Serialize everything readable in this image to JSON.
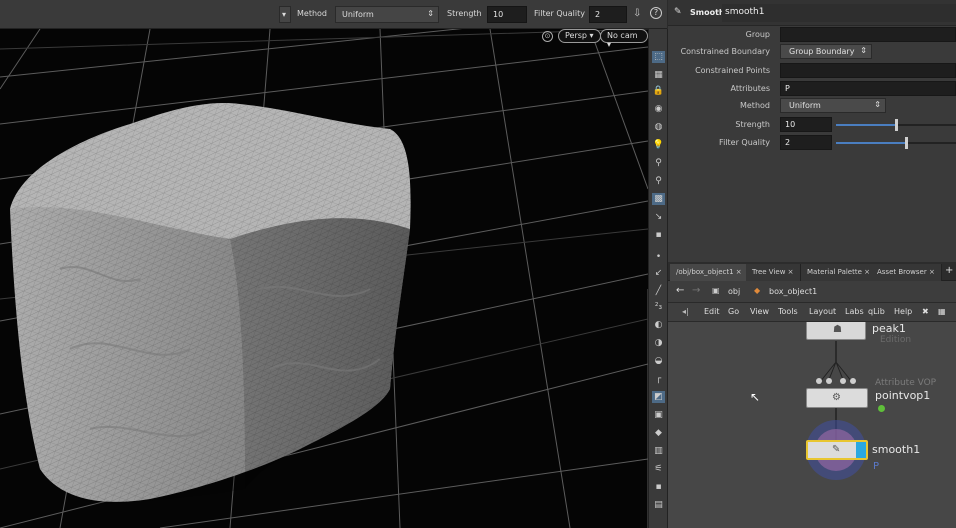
{
  "viewport_toolbar": {
    "method_label": "Method",
    "method_value": "Uniform",
    "strength_label": "Strength",
    "strength_value": "10",
    "filter_quality_label": "Filter Quality",
    "filter_quality_value": "2",
    "help_glyph": "?"
  },
  "viewport": {
    "persp_label": "Persp",
    "cam_label": "No cam"
  },
  "params": {
    "node_type": "Smooth",
    "node_name": "smooth1",
    "group_label": "Group",
    "group_value": "",
    "constrained_boundary_label": "Constrained Boundary",
    "constrained_boundary_value": "Group Boundary",
    "constrained_points_label": "Constrained Points",
    "constrained_points_value": "",
    "attributes_label": "Attributes",
    "attributes_value": "P",
    "method_label": "Method",
    "method_value": "Uniform",
    "strength_label": "Strength",
    "strength_value": "10",
    "strength_level": 0.5,
    "filter_quality_label": "Filter Quality",
    "filter_quality_value": "2",
    "filter_quality_level": 0.58
  },
  "network": {
    "tabs": [
      "/obj/box_object1",
      "Tree View",
      "Material Palette",
      "Asset Browser"
    ],
    "path_root": "obj",
    "path_node": "box_object1",
    "menu": [
      "Edit",
      "Go",
      "View",
      "Tools",
      "Layout",
      "Labs",
      "qLib",
      "Help"
    ],
    "nodes": {
      "peak_name": "peak1",
      "peak_subtitle": "Edition",
      "vop_type": "Attribute VOP",
      "vop_name": "pointvop1",
      "smooth_name": "smooth1",
      "smooth_attr": "P"
    }
  },
  "colors": {
    "accent_blue": "#4a7ec0",
    "display_flag": "#2aa8e0",
    "selected_outline": "#e8c630"
  }
}
